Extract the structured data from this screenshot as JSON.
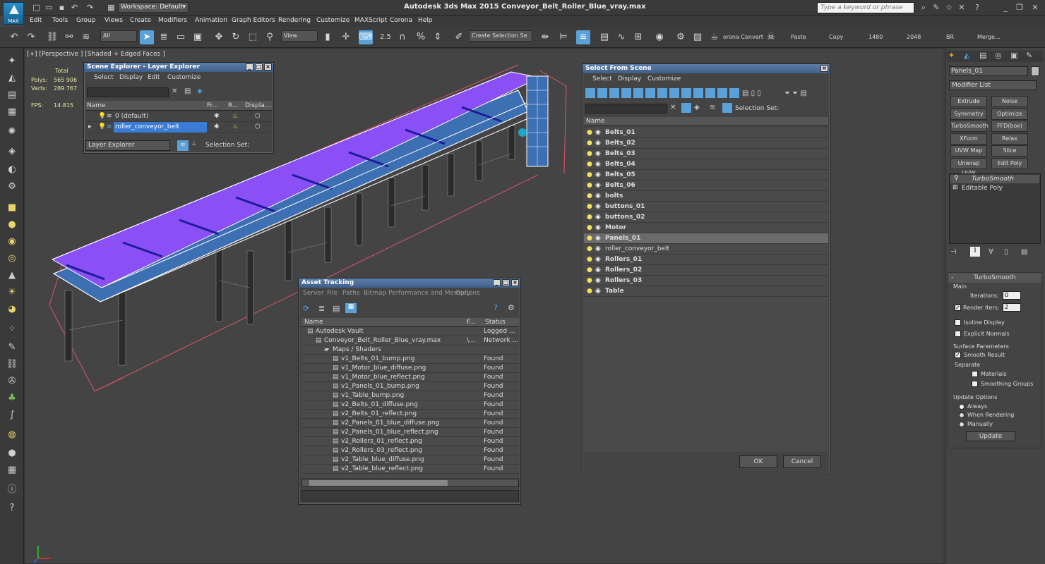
{
  "app": {
    "title": "Autodesk 3ds Max  2015    Conveyor_Belt_Roller_Blue_vray.max",
    "logo_text": "MAX",
    "workspace": "Workspace: Default",
    "help_search_placeholder": "Type a keyword or phrase"
  },
  "menu": [
    "Edit",
    "Tools",
    "Group",
    "Views",
    "Create",
    "Modifiers",
    "Animation",
    "Graph Editors",
    "Rendering",
    "Customize",
    "MAXScript",
    "Corona",
    "Help"
  ],
  "toolbar": {
    "selection_filter": "All",
    "ref_coord": "View",
    "angle_snap": "2.5",
    "percent_snap": "%",
    "named_selection": "Create Selection Se",
    "corona_convert": "orona Convert",
    "paste": "Paste",
    "copy": "Copy",
    "width": "1480",
    "height": "2048",
    "br": "BR",
    "merge": "Merge..."
  },
  "viewport": {
    "label": "[+] [Perspective ] [Shaded + Edged Faces ]",
    "stats": {
      "total_label": "Total",
      "polys_label": "Polys:",
      "polys": "565 906",
      "verts_label": "Verts:",
      "verts": "289 767",
      "fps_label": "FPS:",
      "fps": "14.815"
    }
  },
  "scene_explorer": {
    "title": "Scene Explorer - Layer Explorer",
    "menu": [
      "Select",
      "Display",
      "Edit",
      "Customize"
    ],
    "columns": [
      "Name",
      "Fr...",
      "R...",
      "Displa..."
    ],
    "rows": [
      {
        "name": "0 (default)",
        "selected": false
      },
      {
        "name": "roller_conveyor_belt",
        "selected": true
      }
    ],
    "footer_dropdown": "Layer Explorer",
    "footer_label": "Selection Set:"
  },
  "asset_tracking": {
    "title": "Asset Tracking",
    "menu": [
      "Server",
      "File",
      "Paths",
      "Bitmap Performance and Memory",
      "Options"
    ],
    "columns": [
      "Name",
      "F...",
      "Status"
    ],
    "rows": [
      {
        "name": "Autodesk Vault",
        "f": "",
        "status": "Logged ...",
        "level": 0
      },
      {
        "name": "Conveyor_Belt_Roller_Blue_vray.max",
        "f": "\\...",
        "status": "Network ...",
        "level": 1
      },
      {
        "name": "Maps / Shaders",
        "f": "",
        "status": "",
        "level": 2
      },
      {
        "name": "v1_Belts_01_bump.png",
        "f": "",
        "status": "Found",
        "level": 3
      },
      {
        "name": "v1_Motor_blue_diffuse.png",
        "f": "",
        "status": "Found",
        "level": 3
      },
      {
        "name": "v1_Motor_blue_reflect.png",
        "f": "",
        "status": "Found",
        "level": 3
      },
      {
        "name": "v1_Panels_01_bump.png",
        "f": "",
        "status": "Found",
        "level": 3
      },
      {
        "name": "v1_Table_bump.png",
        "f": "",
        "status": "Found",
        "level": 3
      },
      {
        "name": "v2_Belts_01_diffuse.png",
        "f": "",
        "status": "Found",
        "level": 3
      },
      {
        "name": "v2_Belts_01_reflect.png",
        "f": "",
        "status": "Found",
        "level": 3
      },
      {
        "name": "v2_Panels_01_blue_diffuse.png",
        "f": "",
        "status": "Found",
        "level": 3
      },
      {
        "name": "v2_Panels_01_blue_reflect.png",
        "f": "",
        "status": "Found",
        "level": 3
      },
      {
        "name": "v2_Rollers_01_reflect.png",
        "f": "",
        "status": "Found",
        "level": 3
      },
      {
        "name": "v2_Rollers_03_reflect.png",
        "f": "",
        "status": "Found",
        "level": 3
      },
      {
        "name": "v2_Table_blue_diffuse.png",
        "f": "",
        "status": "Found",
        "level": 3
      },
      {
        "name": "v2_Table_blue_reflect.png",
        "f": "",
        "status": "Found",
        "level": 3
      }
    ]
  },
  "select_from_scene": {
    "title": "Select From Scene",
    "menu": [
      "Select",
      "Display",
      "Customize"
    ],
    "selection_set_label": "Selection Set:",
    "column": "Name",
    "items": [
      {
        "name": "Belts_01",
        "bold": true,
        "highlight": false
      },
      {
        "name": "Belts_02",
        "bold": true,
        "highlight": false
      },
      {
        "name": "Belts_03",
        "bold": true,
        "highlight": false
      },
      {
        "name": "Belts_04",
        "bold": true,
        "highlight": false
      },
      {
        "name": "Belts_05",
        "bold": true,
        "highlight": false
      },
      {
        "name": "Belts_06",
        "bold": true,
        "highlight": false
      },
      {
        "name": "bolts",
        "bold": true,
        "highlight": false
      },
      {
        "name": "buttons_01",
        "bold": true,
        "highlight": false
      },
      {
        "name": "buttons_02",
        "bold": true,
        "highlight": false
      },
      {
        "name": "Motor",
        "bold": true,
        "highlight": false
      },
      {
        "name": "Panels_01",
        "bold": true,
        "highlight": true
      },
      {
        "name": "roller_conveyor_belt",
        "bold": false,
        "highlight": false
      },
      {
        "name": "Rollers_01",
        "bold": true,
        "highlight": false
      },
      {
        "name": "Rollers_02",
        "bold": true,
        "highlight": false
      },
      {
        "name": "Rollers_03",
        "bold": true,
        "highlight": false
      },
      {
        "name": "Table",
        "bold": true,
        "highlight": false
      }
    ],
    "ok": "OK",
    "cancel": "Cancel"
  },
  "command_panel": {
    "object_name": "Panels_01",
    "modifier_list": "Modifier List",
    "modifier_buttons": [
      "Extrude",
      "Noise",
      "Symmetry",
      "Optimize",
      "TurboSmooth",
      "FFD(box)",
      "XForm",
      "Relax",
      "UVW Map",
      "Slice",
      "Unwrap UVW",
      "Edit Poly"
    ],
    "stack": [
      "TurboSmooth",
      "Editable Poly"
    ],
    "rollout_title": "TurboSmooth",
    "main_label": "Main",
    "iterations_label": "Iterations:",
    "iterations": "0",
    "render_iters_label": "Render Iters:",
    "render_iters": "2",
    "isoline": "Isoline Display",
    "explicit_normals": "Explicit Normals",
    "surface_params": "Surface Parameters",
    "smooth_result": "Smooth Result",
    "separate": "Separate",
    "materials": "Materials",
    "smoothing_groups": "Smoothing Groups",
    "update_options": "Update Options",
    "always": "Always",
    "when_rendering": "When Rendering",
    "manually": "Manually",
    "update": "Update"
  },
  "colors": {
    "accent": "#5aa1d8",
    "belt_purple": "#8a4ff5",
    "frame": "#2a2a2a"
  }
}
